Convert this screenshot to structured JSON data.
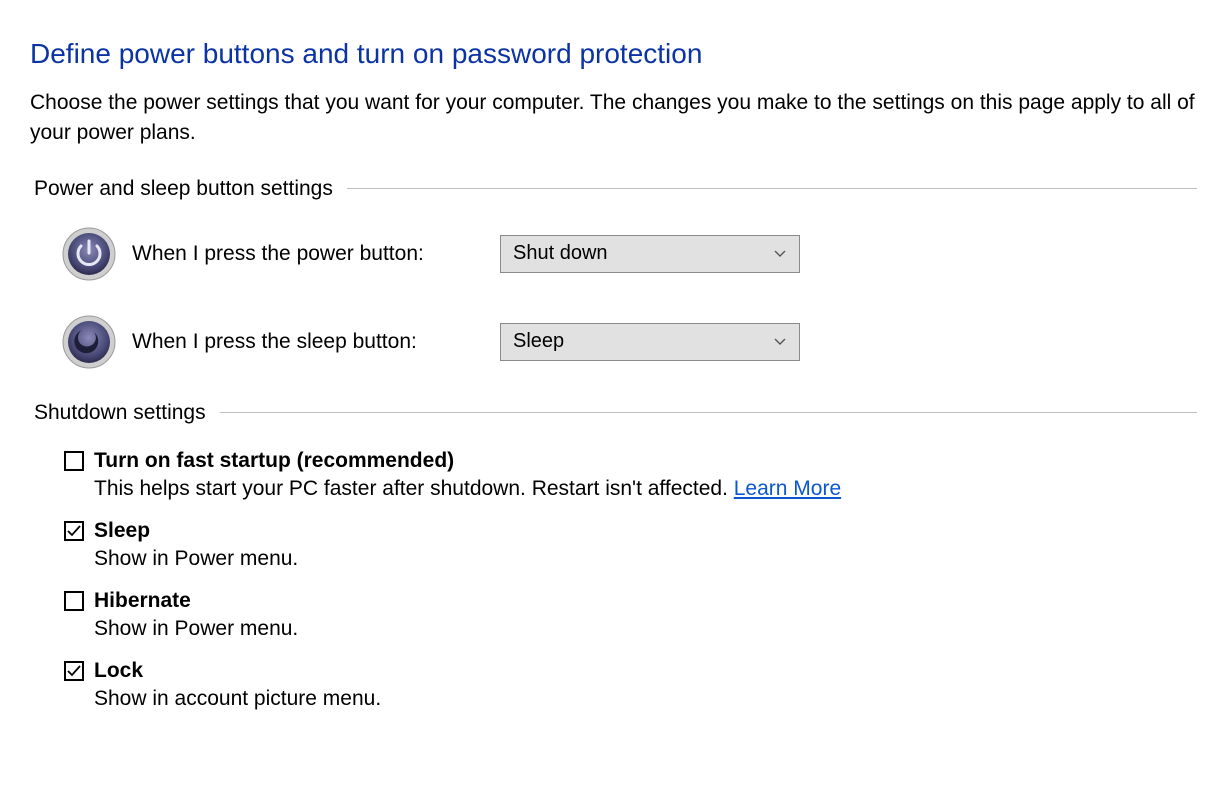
{
  "title": "Define power buttons and turn on password protection",
  "intro": "Choose the power settings that you want for your computer. The changes you make to the settings on this page apply to all of your power plans.",
  "sections": {
    "power_sleep": {
      "heading": "Power and sleep button settings",
      "power_button": {
        "label": "When I press the power button:",
        "value": "Shut down"
      },
      "sleep_button": {
        "label": "When I press the sleep button:",
        "value": "Sleep"
      }
    },
    "shutdown": {
      "heading": "Shutdown settings",
      "items": {
        "fast_startup": {
          "title": "Turn on fast startup (recommended)",
          "desc": "This helps start your PC faster after shutdown. Restart isn't affected. ",
          "learn_more": "Learn More",
          "checked": false
        },
        "sleep": {
          "title": "Sleep",
          "desc": "Show in Power menu.",
          "checked": true
        },
        "hibernate": {
          "title": "Hibernate",
          "desc": "Show in Power menu.",
          "checked": false
        },
        "lock": {
          "title": "Lock",
          "desc": "Show in account picture menu.",
          "checked": true
        }
      }
    }
  }
}
